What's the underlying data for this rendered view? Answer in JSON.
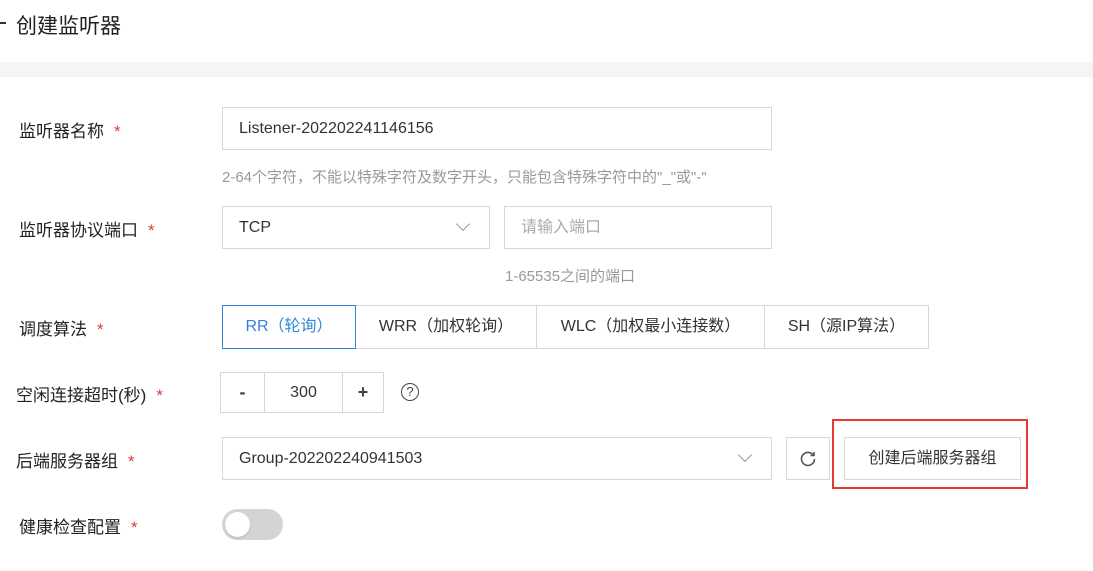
{
  "page": {
    "title": "创建监听器"
  },
  "form": {
    "required_mark": "*",
    "listener_name": {
      "label": "监听器名称",
      "value": "Listener-202202241146156",
      "hint": "2-64个字符，不能以特殊字符及数字开头，只能包含特殊字符中的\"_\"或\"-\""
    },
    "protocol_port": {
      "label": "监听器协议端口",
      "protocol_value": "TCP",
      "port_placeholder": "请输入端口",
      "hint": "1-65535之间的端口"
    },
    "algorithm": {
      "label": "调度算法",
      "options": [
        "RR（轮询）",
        "WRR（加权轮询）",
        "WLC（加权最小连接数）",
        "SH（源IP算法）"
      ],
      "selected": "RR（轮询）"
    },
    "idle_timeout": {
      "label": "空闲连接超时(秒)",
      "decrement_label": "-",
      "value": "300",
      "increment_label": "+",
      "help_label": "?"
    },
    "backend_group": {
      "label": "后端服务器组",
      "value": "Group-202202240941503",
      "create_button_label": "创建后端服务器组"
    },
    "health_check": {
      "label": "健康检查配置",
      "enabled": false
    }
  },
  "colors": {
    "accent": "#2f86d8",
    "required": "#e0393e",
    "highlight": "#e53935"
  }
}
